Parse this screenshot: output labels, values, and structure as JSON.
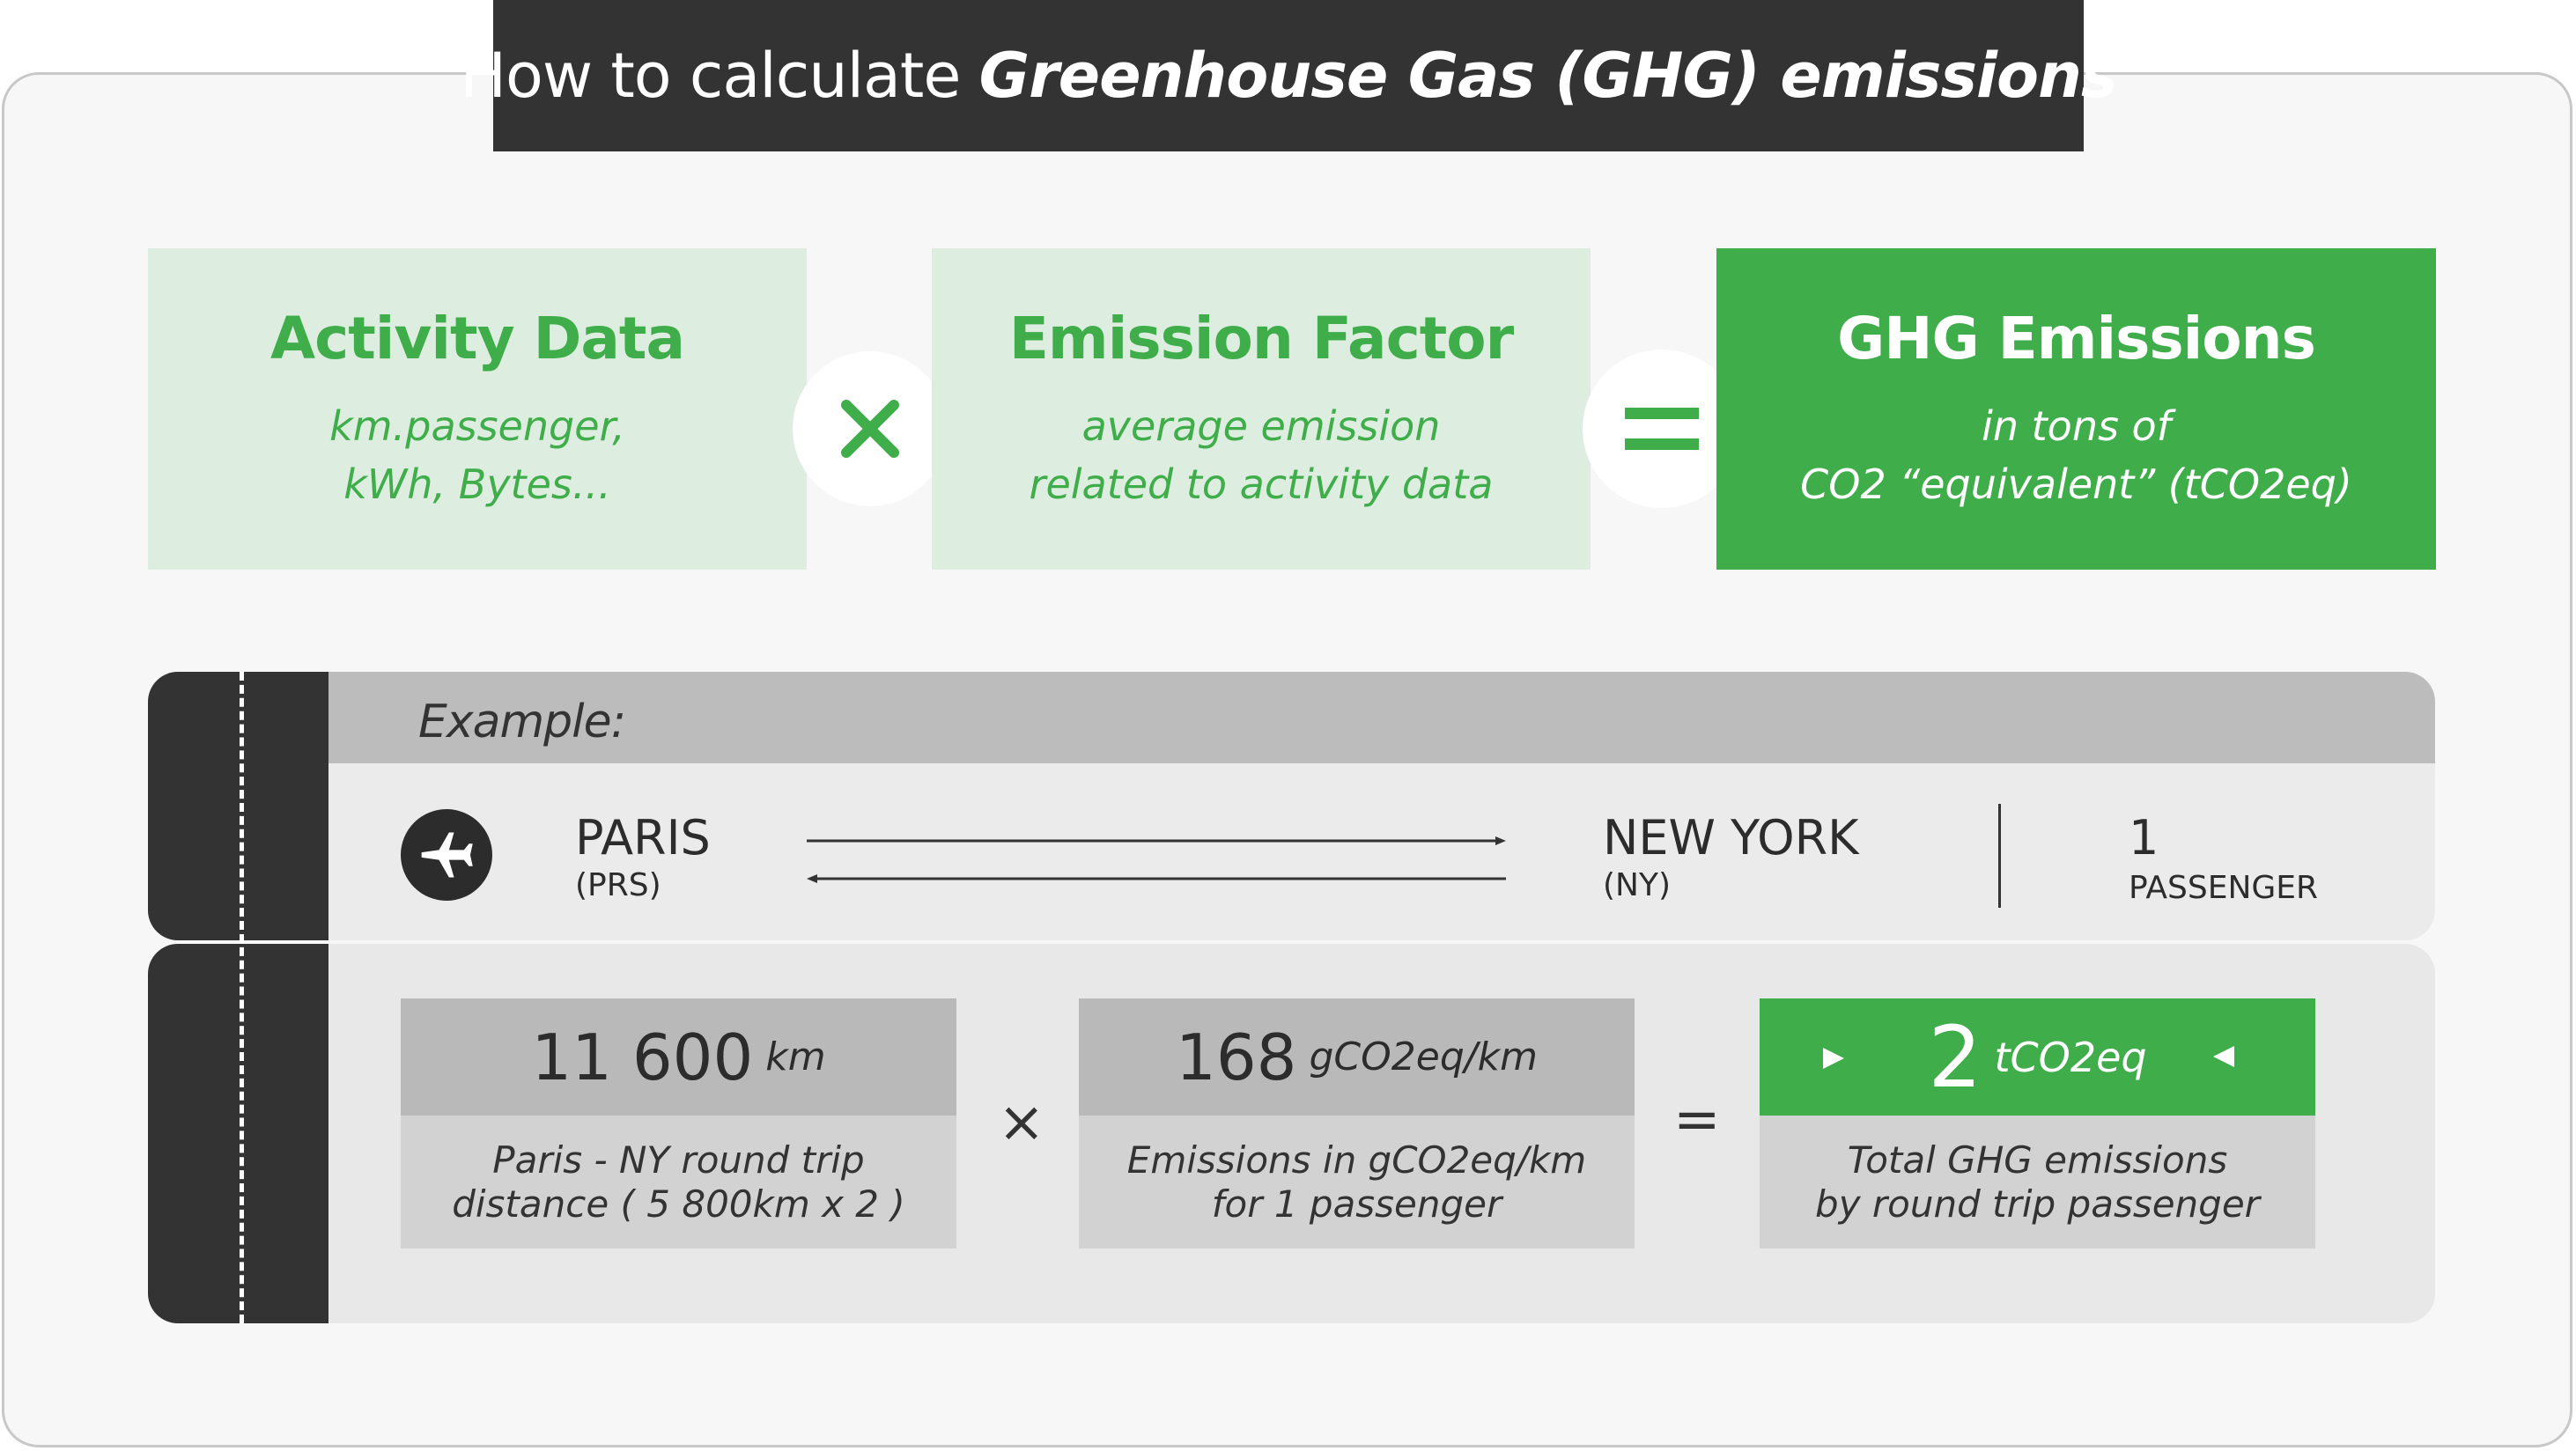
{
  "title": {
    "prefix": "How to calculate ",
    "emphasis": "Greenhouse Gas (GHG) emissions"
  },
  "formula": {
    "activity": {
      "heading": "Activity Data",
      "line1": "km.passenger,",
      "line2": "kWh, Bytes..."
    },
    "factor": {
      "heading": "Emission Factor",
      "line1": "average emission",
      "line2": "related to activity data"
    },
    "result": {
      "heading": "GHG Emissions",
      "line1": "in tons of",
      "line2": "CO2 “equivalent” (tCO2eq)"
    },
    "multiply_icon": "multiply-icon",
    "equals_icon": "equals-icon"
  },
  "example": {
    "label": "Example:",
    "origin": {
      "city": "PARIS",
      "code": "(PRS)"
    },
    "destination": {
      "city": "NEW YORK",
      "code": "(NY)"
    },
    "passengers": {
      "count": "1",
      "label": "PASSENGER"
    },
    "icons": {
      "plane": "airplane-icon",
      "route": "round-trip-arrows-icon"
    },
    "distance": {
      "value": "11 600",
      "unit": "km",
      "line1": "Paris - NY round trip",
      "line2": "distance ( 5 800km x 2 )"
    },
    "factor": {
      "value": "168",
      "unit": "gCO2eq/km",
      "line1": "Emissions in gCO2eq/km",
      "line2": "for 1 passenger"
    },
    "total": {
      "value": "2",
      "unit": "tCO2eq",
      "line1": "Total GHG emissions",
      "line2": "by round trip passenger"
    },
    "times_symbol": "×",
    "equals_symbol": "="
  },
  "colors": {
    "green": "#40ad4b",
    "light_green": "#ddeddf",
    "dark": "#333333",
    "grey": "#bcbcbc"
  }
}
